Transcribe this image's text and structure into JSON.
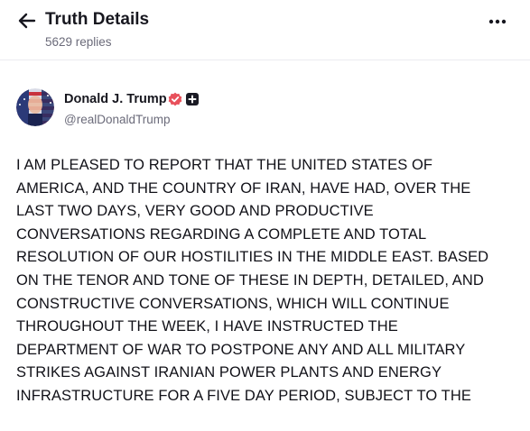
{
  "header": {
    "title": "Truth Details",
    "reply_count": "5629 replies",
    "back_icon": "arrow-left-icon",
    "more_icon": "more-horizontal-icon"
  },
  "author": {
    "name": "Donald J. Trump",
    "handle": "@realDonaldTrump",
    "verified_icon": "verified-badge-icon",
    "plus_icon": "plus-badge-icon",
    "verified_color": "#e8505b"
  },
  "post": {
    "lines": [
      "I AM PLEASED TO REPORT THAT THE UNITED STATES OF",
      "AMERICA, AND THE COUNTRY OF IRAN, HAVE HAD, OVER THE",
      "LAST TWO DAYS, VERY GOOD AND PRODUCTIVE",
      "CONVERSATIONS REGARDING A COMPLETE AND TOTAL",
      "RESOLUTION OF OUR HOSTILITIES IN THE MIDDLE EAST. BASED",
      "ON THE TENOR AND TONE OF THESE IN DEPTH, DETAILED, AND",
      "CONSTRUCTIVE CONVERSATIONS, WHICH WILL CONTINUE",
      "THROUGHOUT THE WEEK, I HAVE INSTRUCTED THE",
      "DEPARTMENT OF WAR TO POSTPONE ANY AND ALL MILITARY",
      "STRIKES AGAINST IRANIAN POWER PLANTS AND ENERGY",
      "INFRASTRUCTURE FOR A FIVE DAY PERIOD, SUBJECT TO THE"
    ]
  }
}
